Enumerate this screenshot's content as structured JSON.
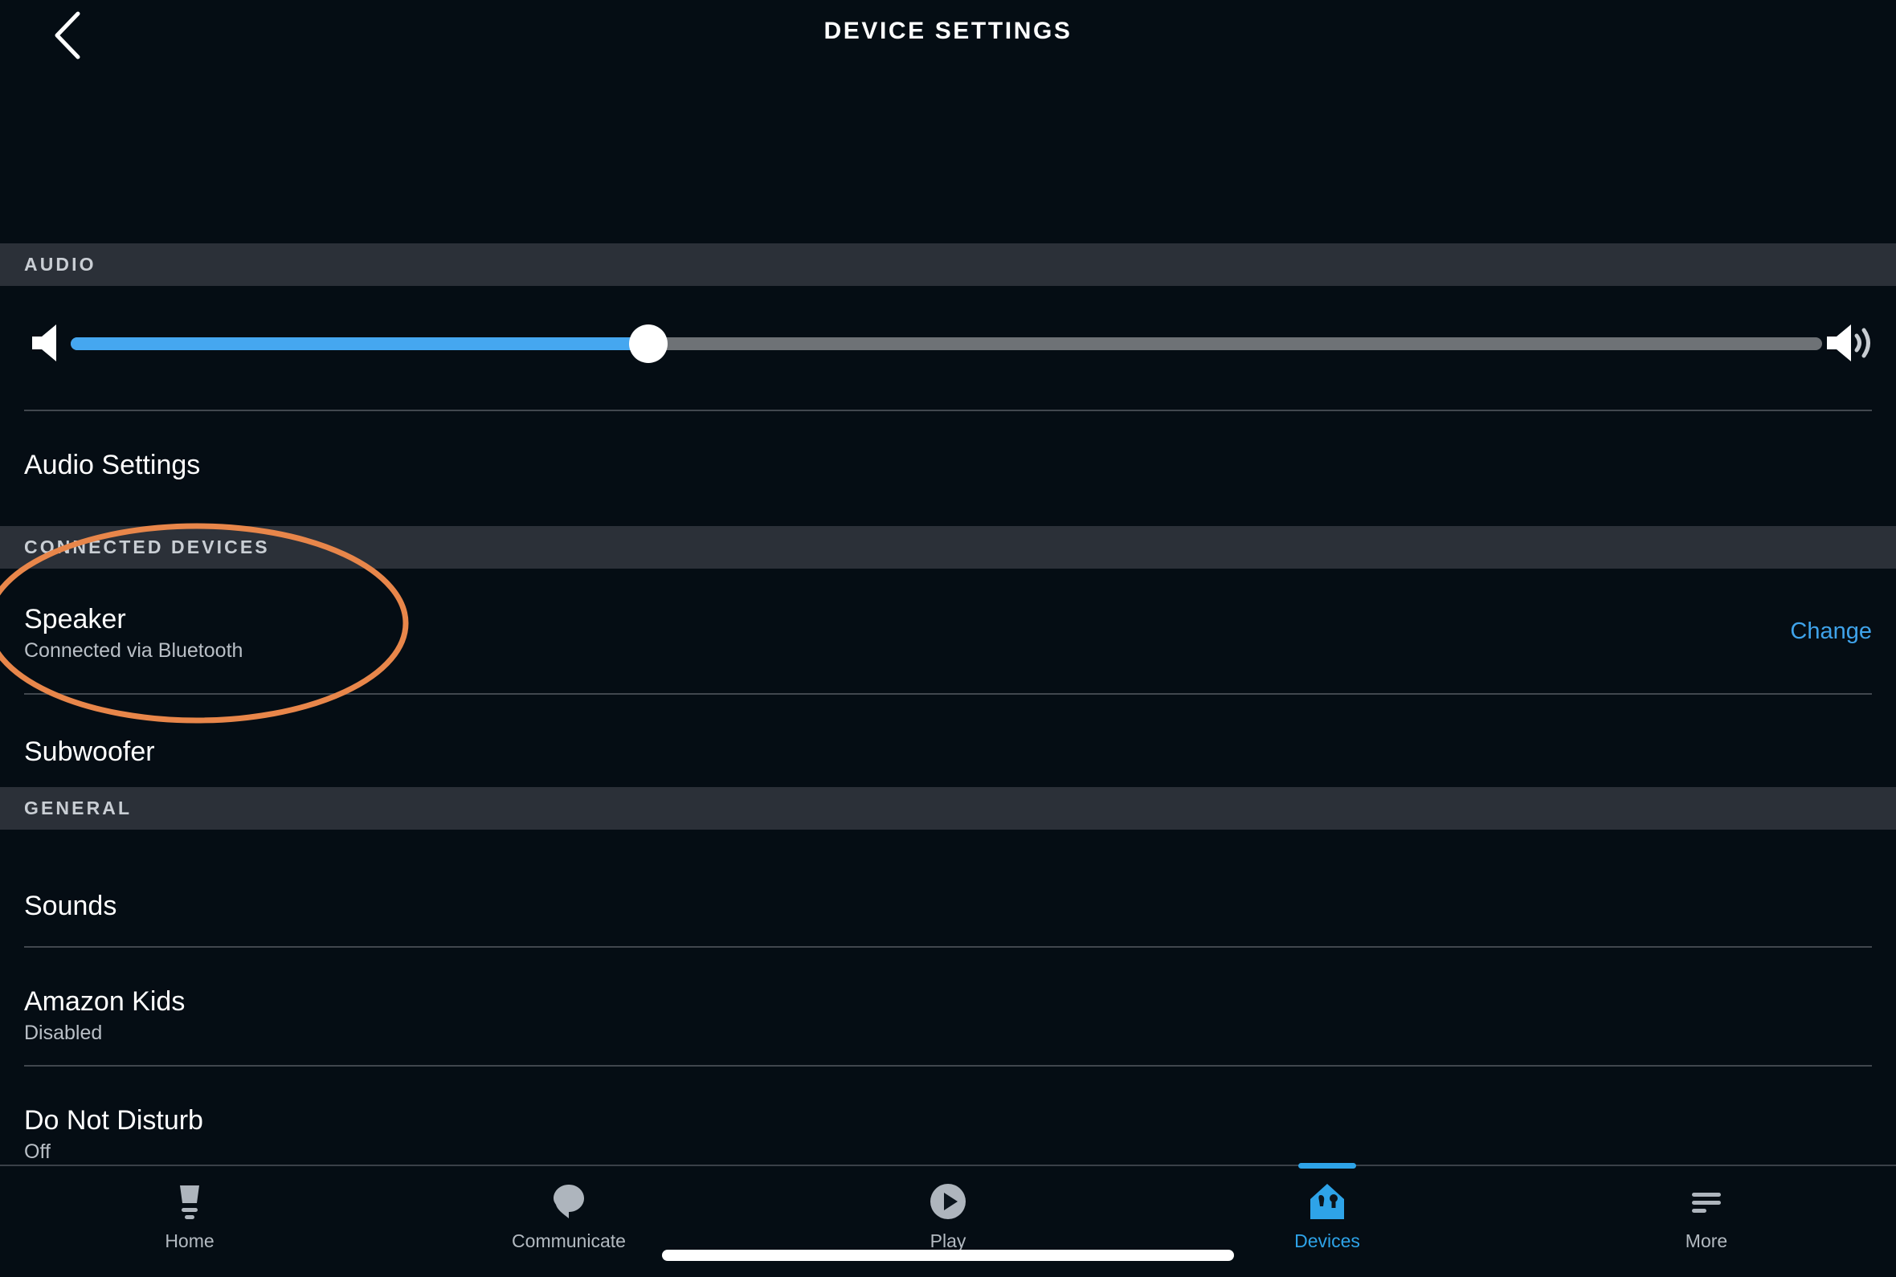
{
  "header": {
    "title": "DEVICE SETTINGS",
    "back_icon": "chevron-left-icon"
  },
  "sections": {
    "audio": {
      "label": "AUDIO",
      "volume": {
        "icon_left": "speaker-mute-icon",
        "icon_right": "speaker-wave-icon",
        "value_percent": 33,
        "fill_color": "#45a7f0",
        "track_color": "#6e7276"
      },
      "items": [
        {
          "title": "Audio Settings",
          "subtitle": "",
          "action": ""
        }
      ]
    },
    "connected_devices": {
      "label": "CONNECTED DEVICES",
      "items": [
        {
          "title": "Speaker",
          "subtitle": "Connected via Bluetooth",
          "action": "Change"
        },
        {
          "title": "Subwoofer",
          "subtitle": "",
          "action": ""
        }
      ]
    },
    "general": {
      "label": "GENERAL",
      "items": [
        {
          "title": "Sounds",
          "subtitle": "",
          "action": ""
        },
        {
          "title": "Amazon Kids",
          "subtitle": "Disabled",
          "action": ""
        },
        {
          "title": "Do Not Disturb",
          "subtitle": "Off",
          "action": ""
        }
      ]
    }
  },
  "annotation": {
    "shape": "ellipse",
    "color": "#e8864a",
    "targets": "Speaker / Connected via Bluetooth row"
  },
  "bottom_nav": {
    "active_index": 3,
    "accent_color": "#2ea3e8",
    "items": [
      {
        "label": "Home",
        "icon": "echo-device-icon"
      },
      {
        "label": "Communicate",
        "icon": "speech-bubble-icon"
      },
      {
        "label": "Play",
        "icon": "play-circle-icon"
      },
      {
        "label": "Devices",
        "icon": "home-devices-icon"
      },
      {
        "label": "More",
        "icon": "hamburger-menu-icon"
      }
    ]
  }
}
